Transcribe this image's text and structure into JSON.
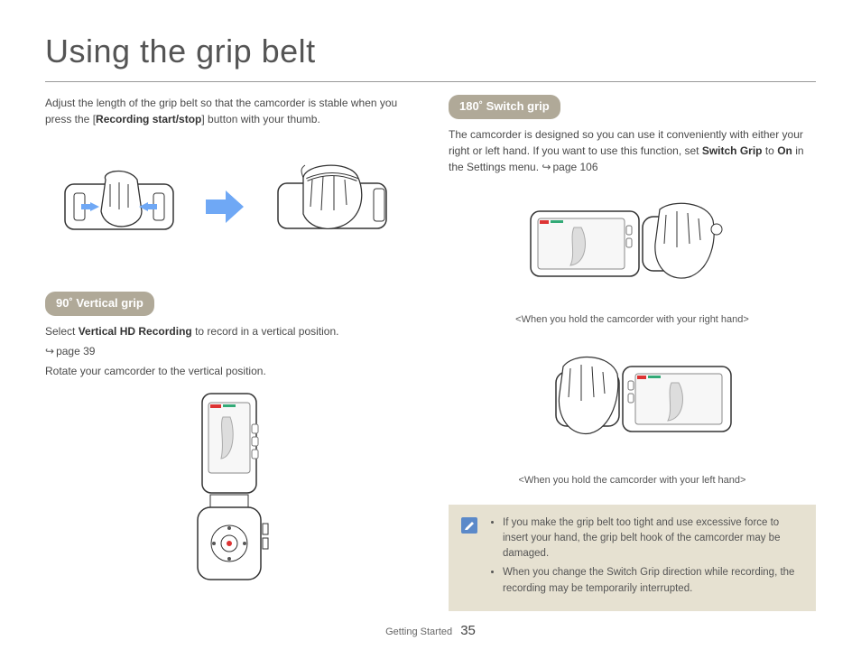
{
  "title": "Using the grip belt",
  "intro": {
    "line1": "Adjust the length of the grip belt so that the camcorder is stable when you press the [",
    "bold": "Recording start/stop",
    "line2": "] button with your thumb."
  },
  "section_vertical": {
    "heading": "90˚ Vertical grip",
    "line_a_pre": "Select ",
    "line_a_bold": "Vertical HD Recording",
    "line_a_post": " to record in a vertical position.",
    "seealso": "page 39",
    "line_b": "Rotate your camcorder to the vertical position."
  },
  "section_switch": {
    "heading": "180˚ Switch grip",
    "para_pre": "The camcorder is designed so you can use it conveniently with either your right or left hand. If you want to use this function, set ",
    "para_bold1": "Switch Grip",
    "para_mid": " to ",
    "para_bold2": "On",
    "para_post": " in the Settings menu. ",
    "seealso": "page 106",
    "caption_right": "<When you hold the camcorder with your right hand>",
    "caption_left": "<When you hold the camcorder with your left hand>"
  },
  "notes": {
    "item1": "If you make the grip belt too tight and use excessive force to insert your hand, the grip belt hook of the camcorder may be damaged.",
    "item2": "When you change the Switch Grip direction while recording, the recording may be temporarily interrupted."
  },
  "footer": {
    "section": "Getting Started",
    "page": "35"
  }
}
